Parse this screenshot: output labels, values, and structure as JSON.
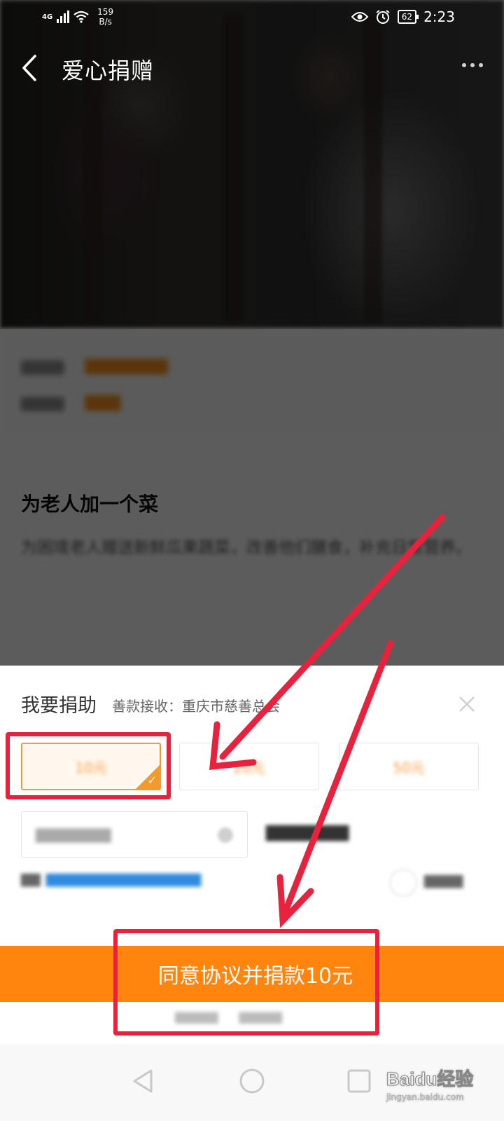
{
  "status_bar": {
    "network": "4G",
    "speed_value": "159",
    "speed_unit": "B/s",
    "battery": "62",
    "time": "2:23"
  },
  "header": {
    "title": "爱心捐赠"
  },
  "project": {
    "title": "为老人加一个菜",
    "description": "为困境老人赠送新鲜瓜果蔬菜，改善他们膳食，补充日常营养。"
  },
  "donation": {
    "title": "我要捐助",
    "receiver": "善款接收：重庆市慈善总会",
    "amounts": [
      {
        "label": "10元",
        "selected": true
      },
      {
        "label": "20元",
        "selected": false
      },
      {
        "label": "50元",
        "selected": false
      }
    ],
    "confirm_button": "同意协议并捐款10元"
  },
  "colors": {
    "accent_orange": "#ff850f",
    "highlight_red": "#e8213c"
  },
  "watermark": {
    "logo": "Baidu经验",
    "url": "jingyan.baidu.com"
  }
}
